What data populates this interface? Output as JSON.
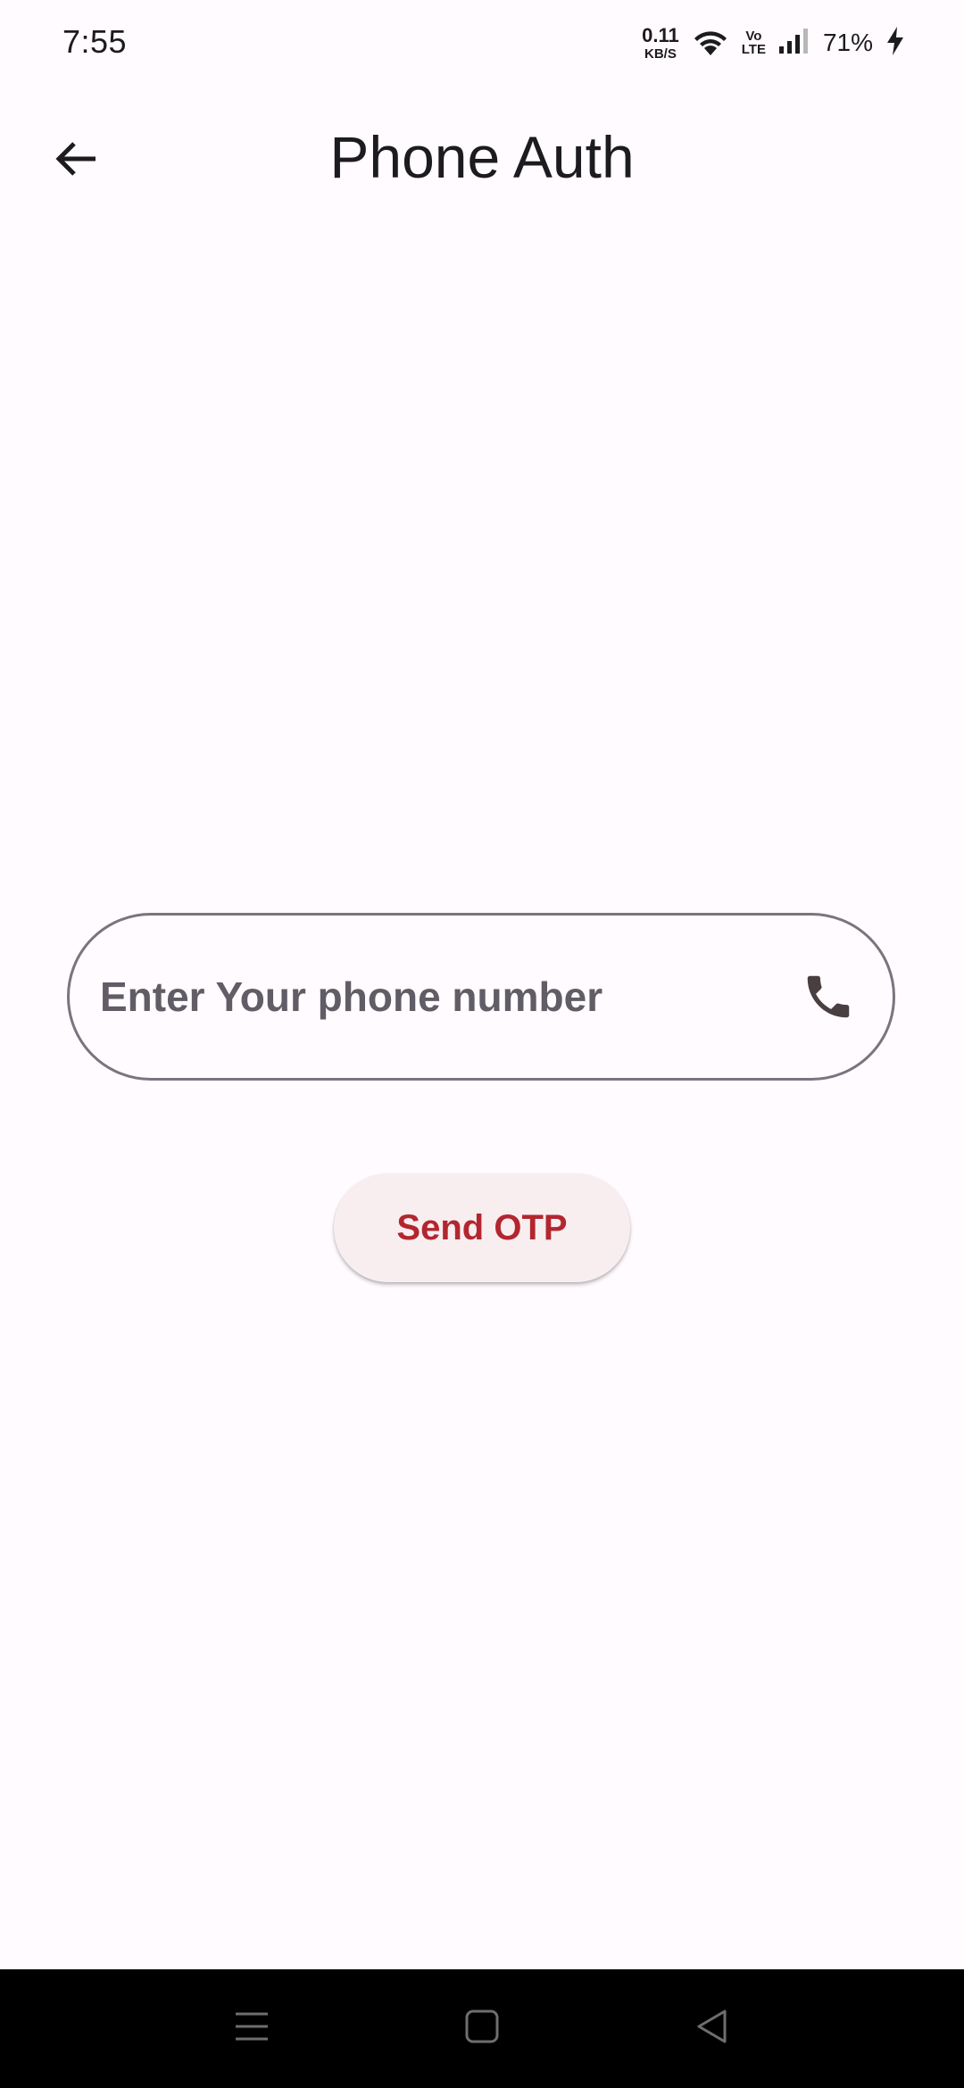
{
  "status_bar": {
    "time": "7:55",
    "net_speed_value": "0.11",
    "net_speed_unit": "KB/S",
    "volte_top": "Vo",
    "volte_bottom": "LTE",
    "battery": "71%",
    "icons": [
      "wifi-icon",
      "volte-icon",
      "signal-icon",
      "charging-icon"
    ]
  },
  "app_bar": {
    "title": "Phone Auth",
    "back_icon": "arrow-back-icon"
  },
  "phone_field": {
    "placeholder": "Enter Your phone number",
    "value": "",
    "icon": "phone-icon"
  },
  "send_otp": {
    "label": "Send OTP"
  },
  "nav_bar": {
    "icons": [
      "menu-icon",
      "home-icon",
      "back-icon"
    ]
  },
  "colors": {
    "background": "#fffbfe",
    "outline": "#79747e",
    "accent": "#b3262f",
    "button_bg": "#f8eef0",
    "phone_icon": "#4a3f40",
    "nav_bar": "#000000"
  }
}
